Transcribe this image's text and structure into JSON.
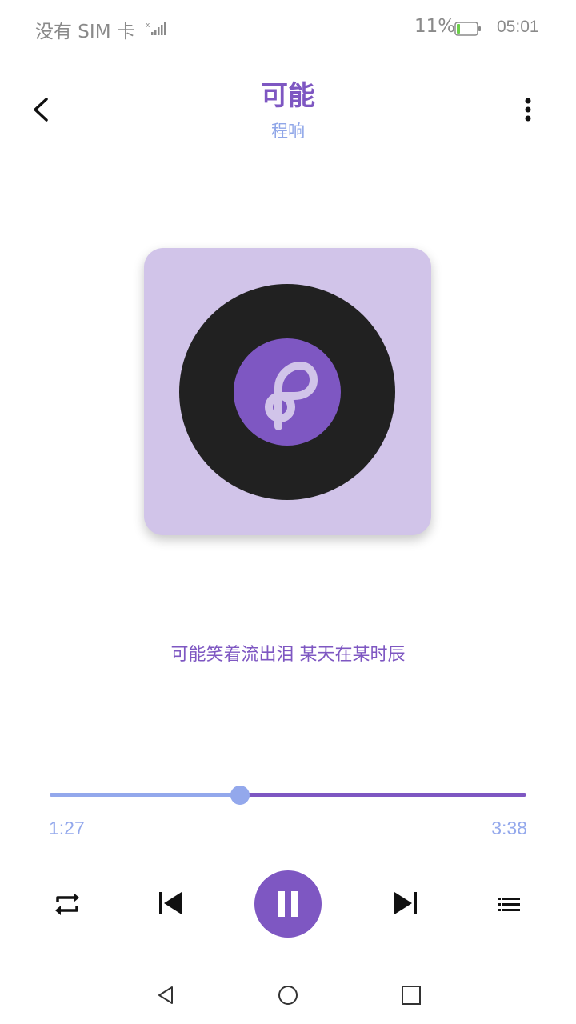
{
  "status_bar": {
    "carrier": "没有 SIM 卡",
    "battery": "11%",
    "time": "05:01",
    "signal_icon": "signal-icon",
    "battery_icon": "battery-icon"
  },
  "header": {
    "title": "可能",
    "artist": "程响",
    "back_icon": "chevron-left-icon",
    "more_icon": "more-vertical-icon"
  },
  "album": {
    "art_icon": "music-note-icon"
  },
  "lyric": "可能笑着流出泪  某天在某时辰",
  "player": {
    "elapsed": "1:27",
    "total": "3:38",
    "progress_fraction": 0.4
  },
  "controls": {
    "repeat_icon": "repeat-icon",
    "prev_icon": "skip-previous-icon",
    "play_pause_icon": "pause-icon",
    "next_icon": "skip-next-icon",
    "playlist_icon": "playlist-icon"
  },
  "colors": {
    "accent": "#7e57c2",
    "secondary": "#93a8ec",
    "album_bg": "#d1c4e9",
    "disc": "#212121"
  },
  "nav_bar": {
    "back_icon": "triangle-back-icon",
    "home_icon": "circle-home-icon",
    "recents_icon": "square-recents-icon"
  }
}
